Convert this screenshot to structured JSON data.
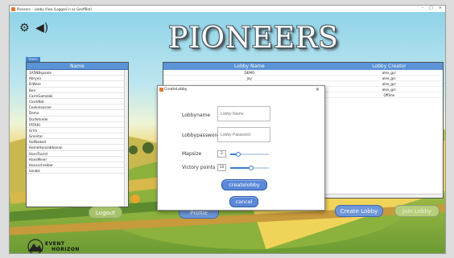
{
  "window": {
    "title": "Pioneers – Lobby View (Logged in as GeoffBot)",
    "controls": [
      "–",
      "□",
      "×"
    ]
  },
  "colors": {
    "header_blue": "#5a93d6",
    "button_blue": "#5b88d8",
    "button_green": "#a8c860"
  },
  "top_icons": {
    "settings": "gear-icon",
    "sound": "speaker-icon"
  },
  "game_title": "PIONEERS",
  "players": {
    "tab": "Users",
    "header": "Name",
    "items": [
      "1A5NBspanle",
      "Abryna",
      "B-Ware",
      "Ben",
      "CarmGamzaki",
      "ClockNot",
      "Cookieousser",
      "Demo",
      "Dorfehreler",
      "FATARI",
      "Grim",
      "Gronitar",
      "Halfbaked",
      "Hamelkonzabbanan",
      "HansTourst",
      "HansMeier",
      "Hansschreiber",
      "Ianabs"
    ]
  },
  "lobbies": {
    "headers": [
      "Lobby Name",
      "Lobby Creator"
    ],
    "rows": [
      [
        "DEMO",
        "alex_gcr"
      ],
      [
        "jay",
        "alex_gcr"
      ],
      [
        "",
        "alex_gcr"
      ],
      [
        "",
        "alex_gcr"
      ],
      [
        "",
        "Offline"
      ]
    ]
  },
  "buttons": {
    "left": "Logout",
    "create_lobby": "Create Lobby",
    "join_lobby": "Join Lobby",
    "partial": "Profile"
  },
  "dialog": {
    "title": "CreateLobby",
    "close": "×",
    "lobbyname_label": "Lobbyname",
    "lobbyname_placeholder": "Lobby Name",
    "lobbypassword_label": "Lobbypassword",
    "lobbypassword_placeholder": "Lobby Password",
    "mapsize_label": "Mapsize",
    "mapsize_value": "2",
    "mapsize_fraction": 0.2,
    "victory_label": "Victory points",
    "victory_value": "10",
    "victory_fraction": 0.55,
    "create_button": "createlobby",
    "cancel_button": "cancel"
  },
  "logo": {
    "line1": "EVENT",
    "line2": "HORIZON"
  }
}
